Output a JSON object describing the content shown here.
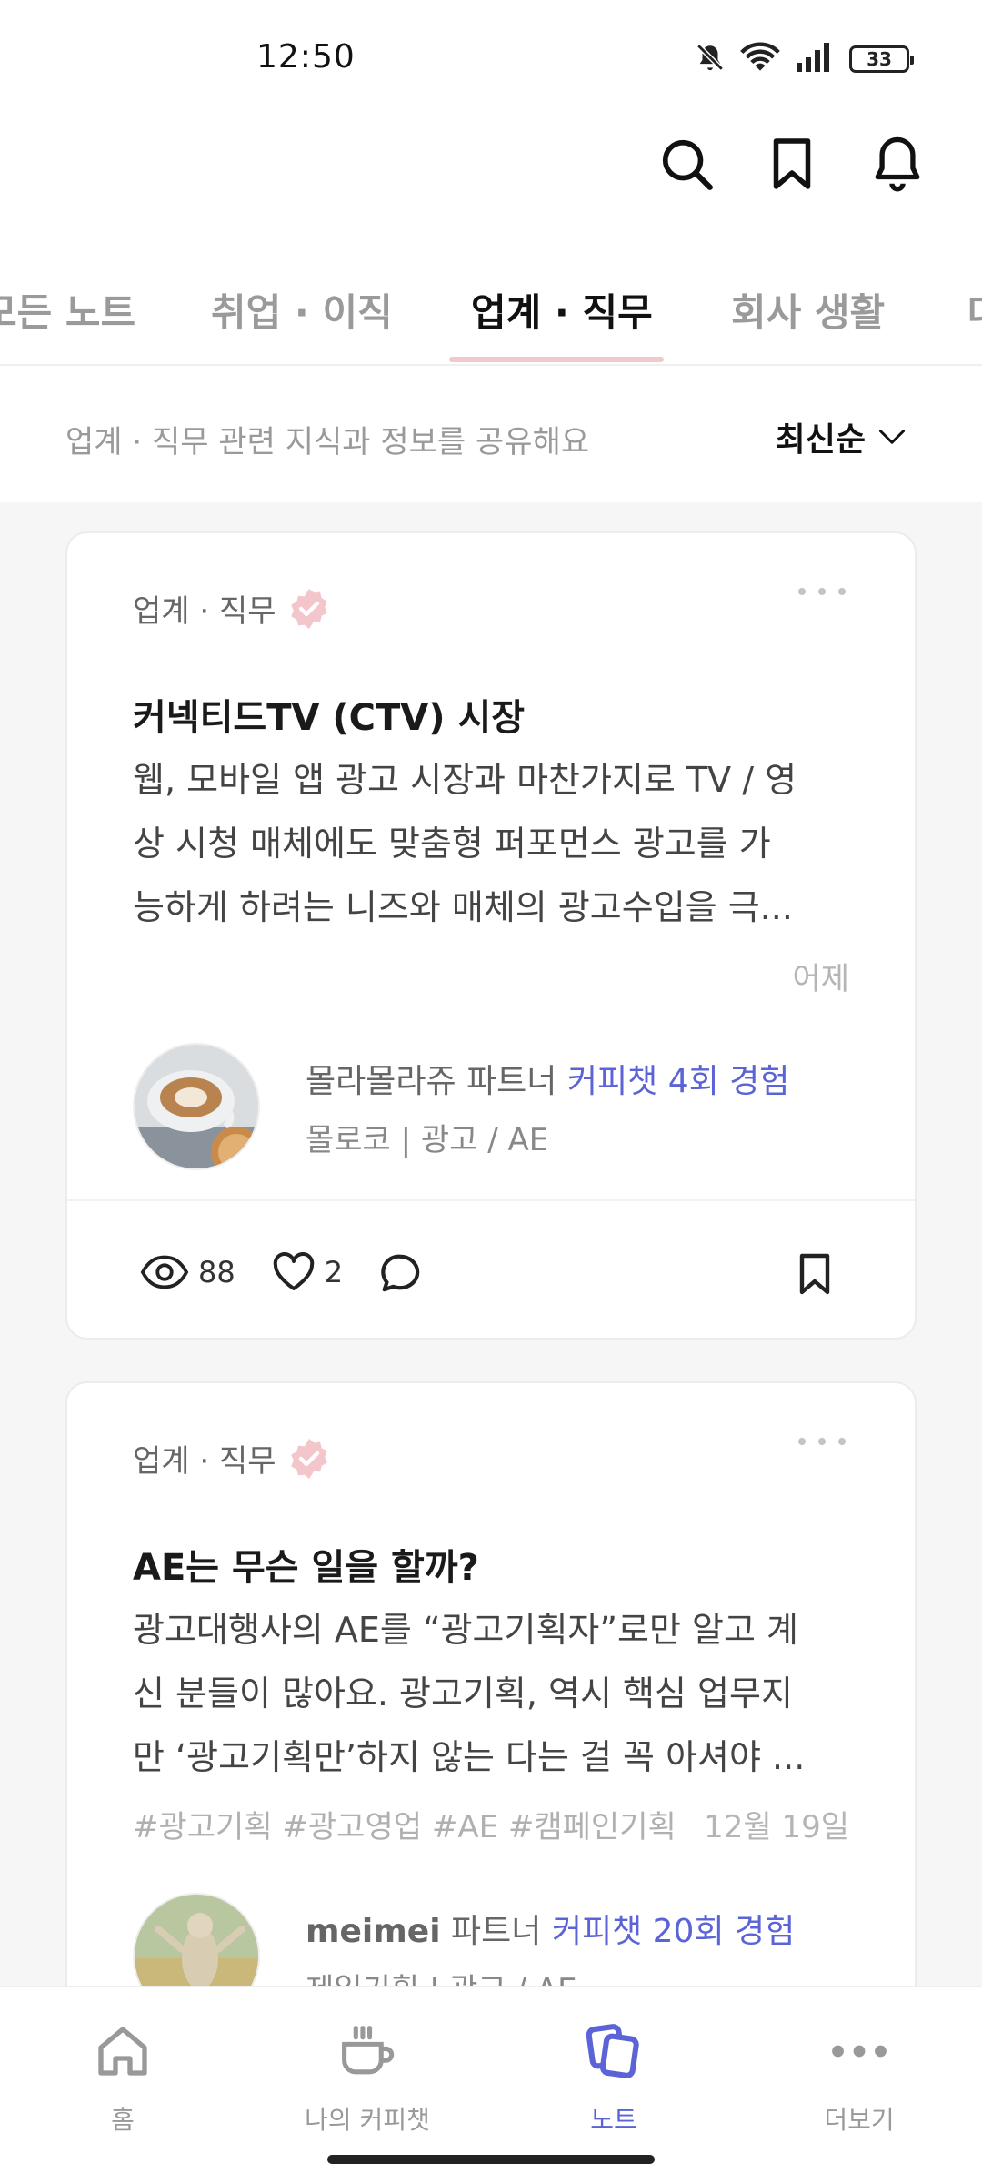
{
  "status": {
    "time": "12:50",
    "battery": "33"
  },
  "tabs": [
    {
      "label": "모든 노트"
    },
    {
      "label": "취업 · 이직"
    },
    {
      "label": "업계 · 직무"
    },
    {
      "label": "회사 생활"
    },
    {
      "label": "대"
    }
  ],
  "subheader": {
    "description": "업계 · 직무 관련 지식과 정보를 공유해요",
    "sort": "최신순"
  },
  "posts": [
    {
      "category": "업계 · 직무",
      "title": "커넥티드TV (CTV) 시장",
      "body_lines": [
        "웹, 모바일 앱 광고 시장과 마찬가지로 TV / 영",
        "상 시청 매체에도 맞춤형 퍼포먼스 광고를 가",
        "능하게 하려는 니즈와 매체의 광고수입을 극..."
      ],
      "tags": "",
      "date": "어제",
      "author": {
        "name": "몰라몰라쥬",
        "role": "파트너",
        "experience": "커피챗 4회 경험",
        "detail": "몰로코 | 광고 / AE"
      },
      "views": "88",
      "likes": "2"
    },
    {
      "category": "업계 · 직무",
      "title": "AE는 무슨 일을 할까?",
      "body_lines": [
        "광고대행사의 AE를 “광고기획자”로만 알고 계",
        "신 분들이 많아요. 광고기획, 역시 핵심 업무지",
        "만 ‘광고기획만’하지 않는 다는 걸 꼭 아셔야 ..."
      ],
      "tags": "#광고기획 #광고영업 #AE #캠페인기획",
      "date": "12월 19일",
      "author": {
        "name": "meimei",
        "role": "파트너",
        "experience": "커피챗 20회 경험",
        "detail": "제일기획 | 광고 / AE"
      }
    }
  ],
  "nav": [
    {
      "label": "홈",
      "icon": "home-icon"
    },
    {
      "label": "나의 커피챗",
      "icon": "coffee-cup-icon"
    },
    {
      "label": "노트",
      "icon": "notes-icon"
    },
    {
      "label": "더보기",
      "icon": "more-icon"
    }
  ],
  "colors": {
    "accent": "#5b63d6",
    "tab_underline": "#f0c9cd",
    "verified_badge": "#f3c6cb",
    "feed_bg": "#f6f6f6"
  }
}
